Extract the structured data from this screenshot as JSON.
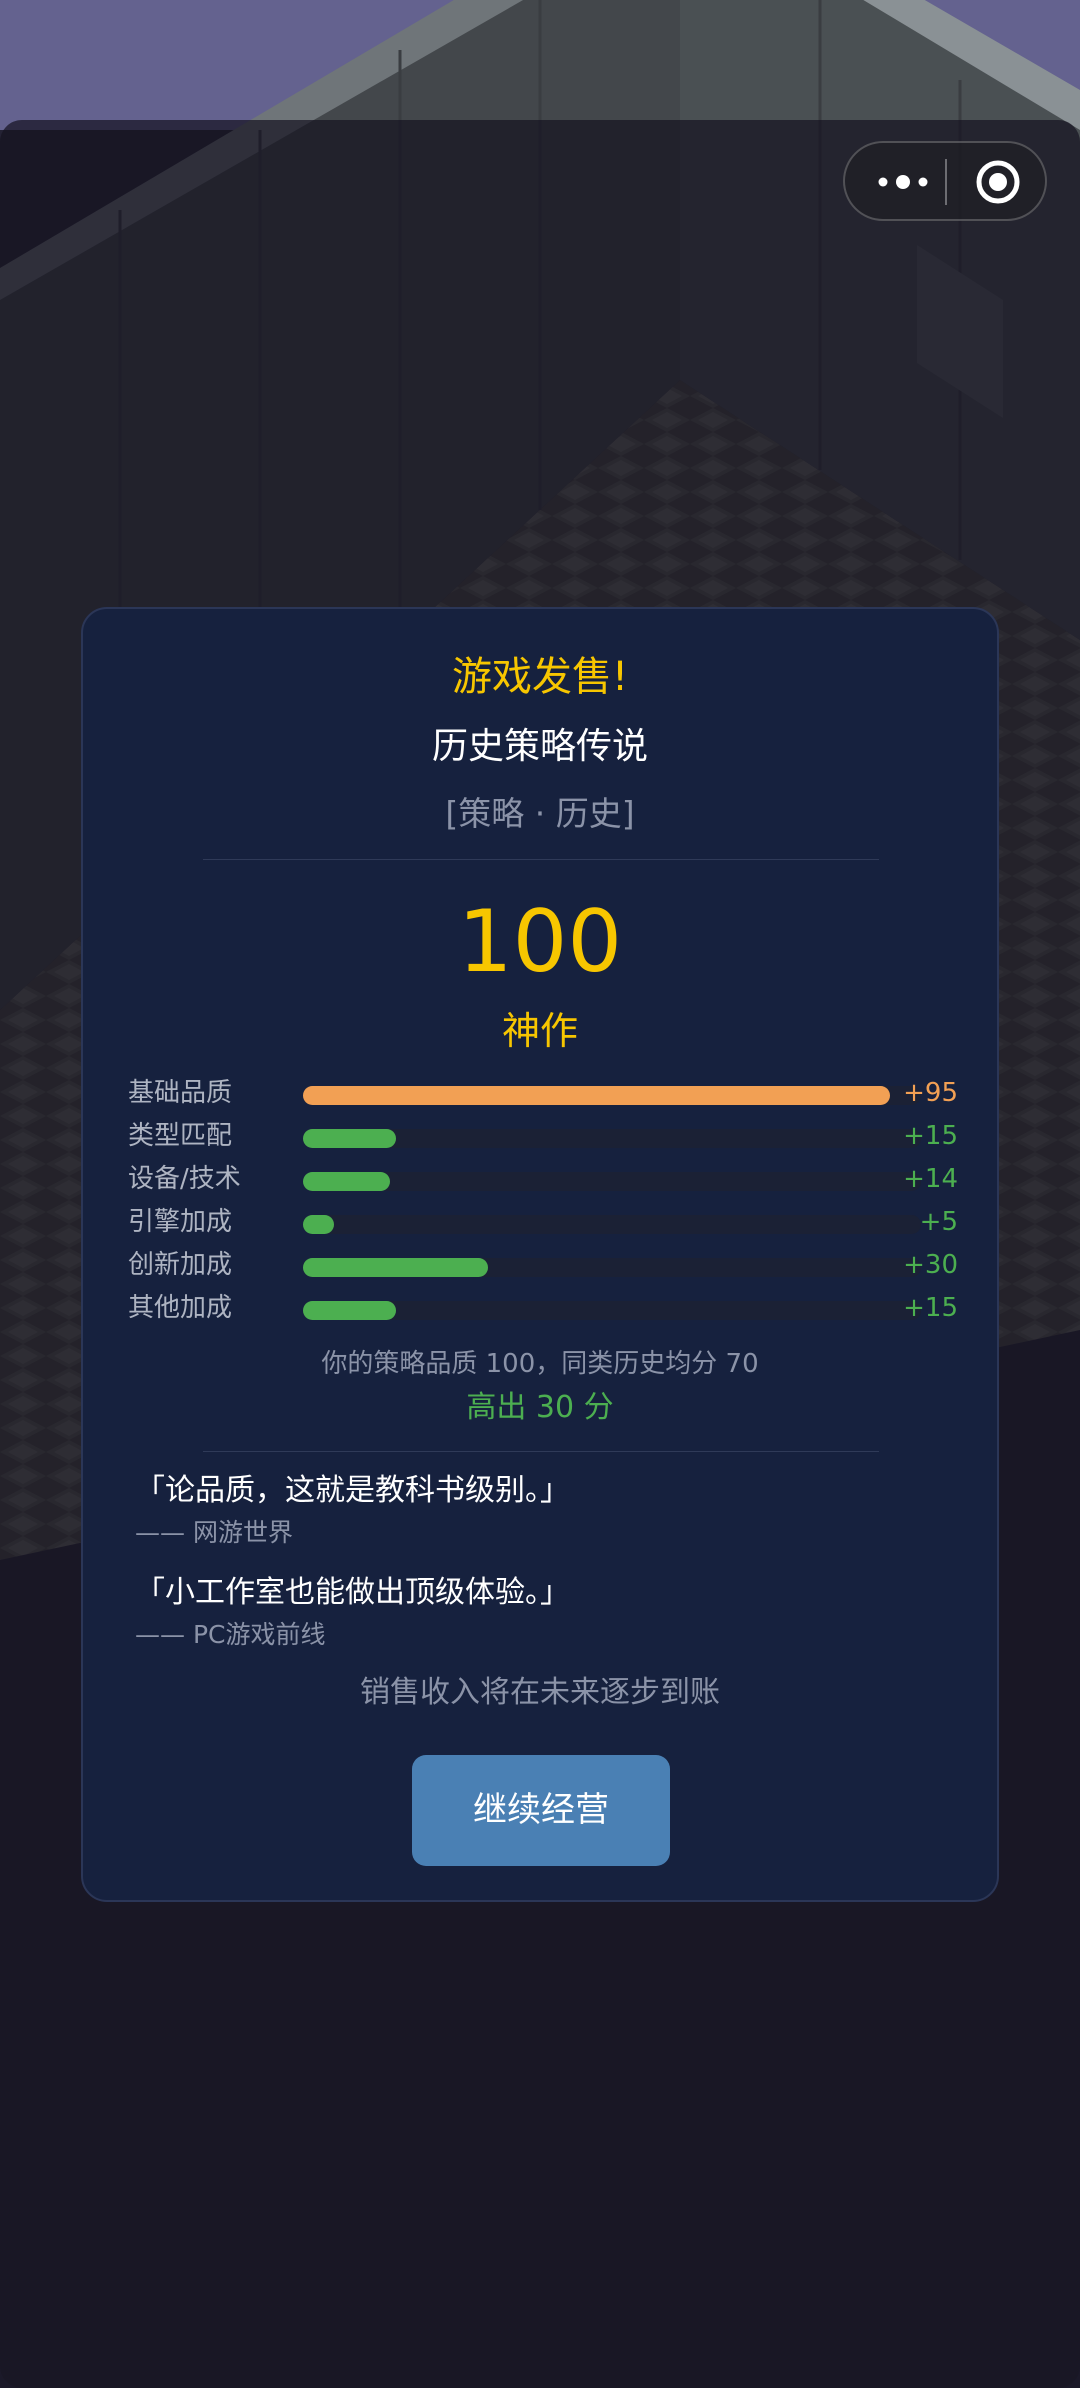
{
  "capsule": {
    "more_icon": "more-dots-icon",
    "close_icon": "target-circle-icon"
  },
  "panel": {
    "title": "游戏发售!",
    "game_name": "历史策略传说",
    "genre": "[策略 · 历史]",
    "score": "100",
    "rating": "神作",
    "breakdown": [
      {
        "label": "基础品质",
        "value_text": "+95",
        "value": 95,
        "color": "#f2a054"
      },
      {
        "label": "类型匹配",
        "value_text": "+15",
        "value": 15,
        "color": "#4caf50"
      },
      {
        "label": "设备/技术",
        "value_text": "+14",
        "value": 14,
        "color": "#4caf50"
      },
      {
        "label": "引擎加成",
        "value_text": "+5",
        "value": 5,
        "color": "#4caf50"
      },
      {
        "label": "创新加成",
        "value_text": "+30",
        "value": 30,
        "color": "#4caf50"
      },
      {
        "label": "其他加成",
        "value_text": "+15",
        "value": 15,
        "color": "#4caf50"
      }
    ],
    "compare_text": "你的策略品质 100，同类历史均分 70",
    "compare_diff": "高出 30 分",
    "reviews": [
      {
        "quote": "「论品质，这就是教科书级别。」",
        "source": "—— 网游世界"
      },
      {
        "quote": "「小工作室也能做出顶级体验。」",
        "source": "—— PC游戏前线"
      }
    ],
    "sales_note": "销售收入将在未来逐步到账",
    "continue_label": "继续经营"
  },
  "colors": {
    "accent": "#f7c600",
    "positive": "#4caf50",
    "base": "#f2a054",
    "button": "#4a80b4",
    "panel": "#16213e"
  }
}
